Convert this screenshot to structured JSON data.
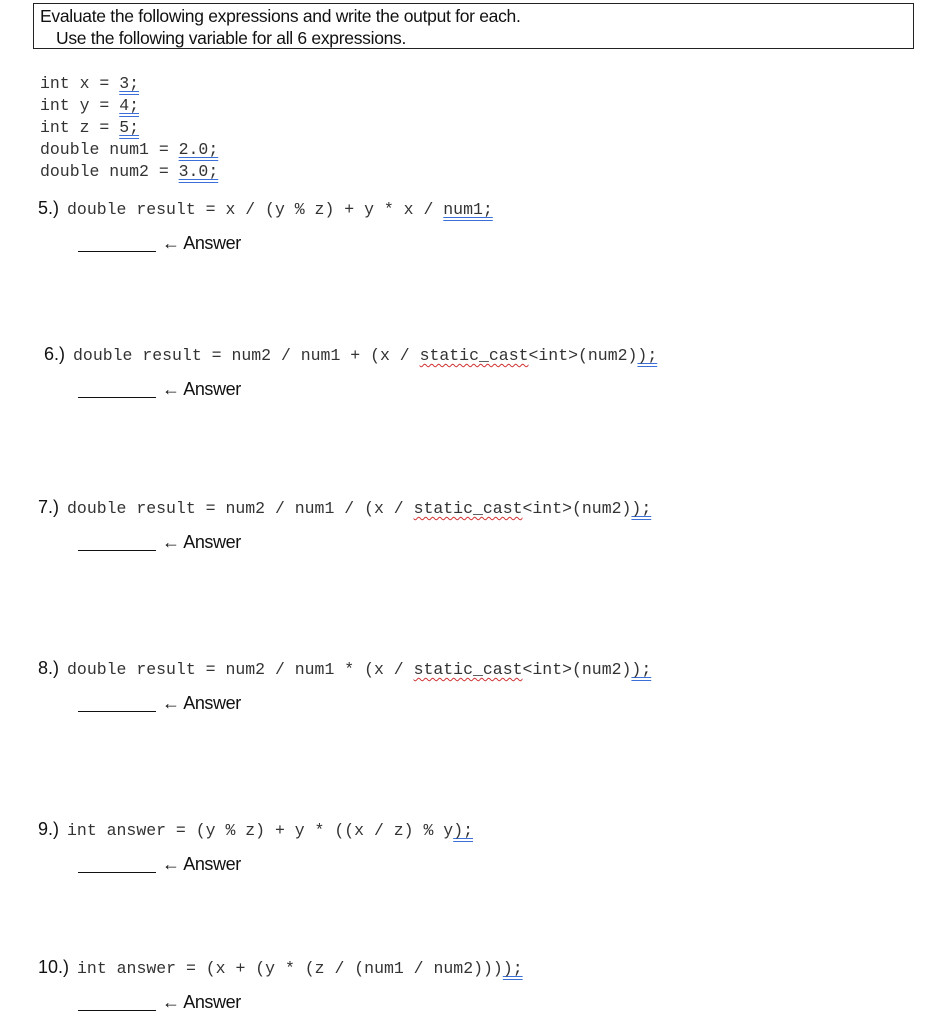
{
  "header": {
    "line1": "Evaluate the following expressions and write the output for each.",
    "line2": "Use the following variable for all 6 expressions."
  },
  "variables": [
    {
      "decl": "int x = ",
      "value": "3;"
    },
    {
      "decl": "int y = ",
      "value": "4;"
    },
    {
      "decl": "int z = ",
      "value": "5;"
    },
    {
      "decl": "double num1 = ",
      "value": "2.0;"
    },
    {
      "decl": "double num2 = ",
      "value": "3.0;"
    }
  ],
  "questions": [
    {
      "num": "5.)",
      "code_a": "double result = x / (y % z) + y * x / ",
      "code_sq": "",
      "code_b": "",
      "code_ul": "num1;",
      "answer_label": "← Answer"
    },
    {
      "num": "6.)",
      "code_a": "double result = num2 / num1 + (x / ",
      "code_sq": "static_cast",
      "code_b": "<int>(num2)",
      "code_ul": ");",
      "answer_label": "← Answer"
    },
    {
      "num": "7.)",
      "code_a": "double result = num2 / num1 / (x / ",
      "code_sq": "static_cast",
      "code_b": "<int>(num2)",
      "code_ul": ");",
      "answer_label": "← Answer"
    },
    {
      "num": "8.)",
      "code_a": "double result = num2 / num1 * (x / ",
      "code_sq": "static_cast",
      "code_b": "<int>(num2)",
      "code_ul": ");",
      "answer_label": "← Answer"
    },
    {
      "num": "9.)",
      "code_a": "int answer = (y % z) + y * ((x / z) % y",
      "code_sq": "",
      "code_b": "",
      "code_ul": ");",
      "answer_label": "← Answer"
    },
    {
      "num": "10.)",
      "code_a": "int answer = (x + (y * (z / (num1 / num2)))",
      "code_sq": "",
      "code_b": "",
      "code_ul": ");",
      "answer_label": "← Answer"
    }
  ]
}
